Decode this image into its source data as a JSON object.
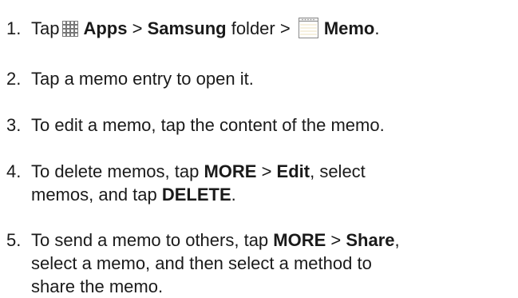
{
  "steps": [
    {
      "number": "1.",
      "tap": "Tap",
      "apps_icon": "apps-grid-icon",
      "apps": "Apps",
      "sep1": " > ",
      "samsung": "Samsung",
      "folder": " folder > ",
      "memo_icon": "memo-notepad-icon",
      "memo": "Memo",
      "end": "."
    },
    {
      "number": "2.",
      "text": "Tap a memo entry to open it."
    },
    {
      "number": "3.",
      "text": "To edit a memo, tap the content of the memo."
    },
    {
      "number": "4.",
      "a": "To delete memos, tap ",
      "more": "MORE",
      "sep": " > ",
      "edit": "Edit",
      "b": ", select",
      "c": "memos, and tap ",
      "delete": "DELETE",
      "d": "."
    },
    {
      "number": "5.",
      "a": "To send a memo to others, tap ",
      "more": "MORE",
      "sep": " > ",
      "share": "Share",
      "b": ",",
      "line2": "select a memo, and then select a method to",
      "line3": "share the memo."
    }
  ]
}
